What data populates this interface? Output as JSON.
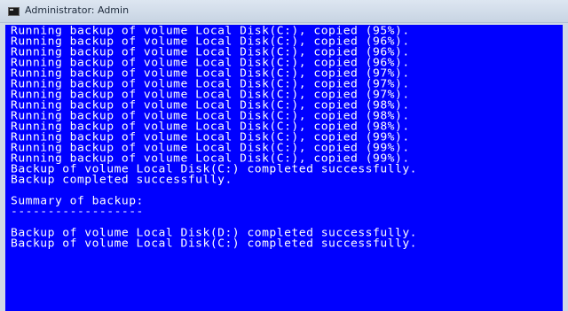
{
  "window": {
    "title": "Administrator: Admin",
    "icon": "command-prompt-icon"
  },
  "console": {
    "background": "#0000ff",
    "foreground": "#ffffff",
    "lines": [
      "Running backup of volume Local Disk(C:), copied (95%).",
      "Running backup of volume Local Disk(C:), copied (96%).",
      "Running backup of volume Local Disk(C:), copied (96%).",
      "Running backup of volume Local Disk(C:), copied (96%).",
      "Running backup of volume Local Disk(C:), copied (97%).",
      "Running backup of volume Local Disk(C:), copied (97%).",
      "Running backup of volume Local Disk(C:), copied (97%).",
      "Running backup of volume Local Disk(C:), copied (98%).",
      "Running backup of volume Local Disk(C:), copied (98%).",
      "Running backup of volume Local Disk(C:), copied (98%).",
      "Running backup of volume Local Disk(C:), copied (99%).",
      "Running backup of volume Local Disk(C:), copied (99%).",
      "Running backup of volume Local Disk(C:), copied (99%).",
      "Backup of volume Local Disk(C:) completed successfully.",
      "Backup completed successfully.",
      "",
      "Summary of backup:",
      "------------------",
      "",
      "Backup of volume Local Disk(D:) completed successfully.",
      "Backup of volume Local Disk(C:) completed successfully."
    ]
  }
}
